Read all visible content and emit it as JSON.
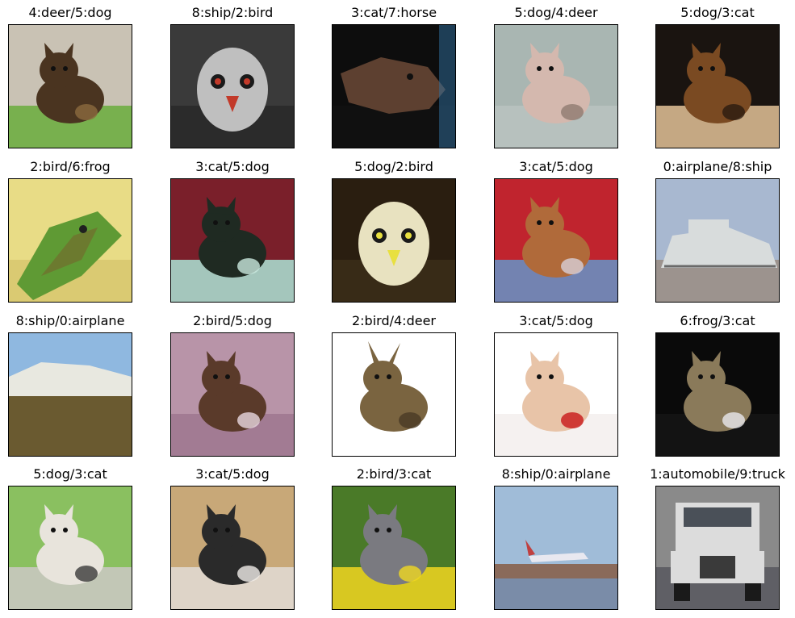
{
  "grid": {
    "cells": [
      {
        "title": "4:deer/5:dog",
        "subject": "dog",
        "bg": "#c9c2b4",
        "ground": "#6fae43",
        "fg": "#4a3420",
        "accent": "#8b6a3e"
      },
      {
        "title": "8:ship/2:bird",
        "subject": "bird",
        "bg": "#3a3a3a",
        "ground": "#2a2a2a",
        "fg": "#bfbfbf",
        "accent": "#c23a2a"
      },
      {
        "title": "3:cat/7:horse",
        "subject": "horse",
        "bg": "#0d0d0d",
        "ground": "#111111",
        "fg": "#5d4030",
        "accent": "#2f6fa0"
      },
      {
        "title": "5:dog/4:deer",
        "subject": "dog",
        "bg": "#a9b6b2",
        "ground": "#b8c2bf",
        "fg": "#d4b8ae",
        "accent": "#8f7a70"
      },
      {
        "title": "5:dog/3:cat",
        "subject": "dog",
        "bg": "#1a1410",
        "ground": "#d8b890",
        "fg": "#7a4a22",
        "accent": "#2a1a10"
      },
      {
        "title": "2:bird/6:frog",
        "subject": "frog",
        "bg": "#e8dc86",
        "ground": "#d8c870",
        "fg": "#5f9a34",
        "accent": "#7a5a2a"
      },
      {
        "title": "3:cat/5:dog",
        "subject": "dog",
        "bg": "#7a1f2a",
        "ground": "#a8d8cc",
        "fg": "#1f2a22",
        "accent": "#c9e8de"
      },
      {
        "title": "5:dog/2:bird",
        "subject": "bird",
        "bg": "#2a1e10",
        "ground": "#3a2c18",
        "fg": "#e8e2c0",
        "accent": "#e8e040"
      },
      {
        "title": "3:cat/5:dog",
        "subject": "dog",
        "bg": "#c0242e",
        "ground": "#6a8ec0",
        "fg": "#b06a3a",
        "accent": "#d8d0d8"
      },
      {
        "title": "0:airplane/8:ship",
        "subject": "ship",
        "bg": "#a8b8d0",
        "ground": "#9a8f86",
        "fg": "#d8dcdc",
        "accent": "#6a6a6a"
      },
      {
        "title": "8:ship/0:airplane",
        "subject": "landscape",
        "bg": "#8fb8e0",
        "ground": "#6a5a30",
        "fg": "#e8e8e0",
        "accent": "#5a4a20"
      },
      {
        "title": "2:bird/5:dog",
        "subject": "dog",
        "bg": "#b894a8",
        "ground": "#a07890",
        "fg": "#5a3a2a",
        "accent": "#e8d8e0"
      },
      {
        "title": "2:bird/4:deer",
        "subject": "deer",
        "bg": "#ffffff",
        "ground": "#ffffff",
        "fg": "#7a6440",
        "accent": "#4a3a24"
      },
      {
        "title": "3:cat/5:dog",
        "subject": "dog",
        "bg": "#ffffff",
        "ground": "#f4f0ee",
        "fg": "#e8c4a8",
        "accent": "#c81818"
      },
      {
        "title": "6:frog/3:cat",
        "subject": "cat",
        "bg": "#0a0a0a",
        "ground": "#141414",
        "fg": "#8a7a5a",
        "accent": "#e8e8ec"
      },
      {
        "title": "5:dog/3:cat",
        "subject": "cat",
        "bg": "#8ac060",
        "ground": "#c8c8c0",
        "fg": "#e8e4dc",
        "accent": "#3a3a3a"
      },
      {
        "title": "3:cat/5:dog",
        "subject": "dog",
        "bg": "#c8a878",
        "ground": "#e0d8d0",
        "fg": "#2a2a2a",
        "accent": "#f0ece8"
      },
      {
        "title": "2:bird/3:cat",
        "subject": "cat",
        "bg": "#4a7a28",
        "ground": "#e8d020",
        "fg": "#7a7a80",
        "accent": "#f0d820"
      },
      {
        "title": "8:ship/0:airplane",
        "subject": "airplane",
        "bg": "#a0bcd8",
        "ground": "#7a8ca8",
        "fg": "#8a6a5a",
        "accent": "#c04040"
      },
      {
        "title": "1:automobile/9:truck",
        "subject": "truck",
        "bg": "#8a8a8a",
        "ground": "#5a5a60",
        "fg": "#dcdcdc",
        "accent": "#3a3a3a"
      }
    ]
  }
}
